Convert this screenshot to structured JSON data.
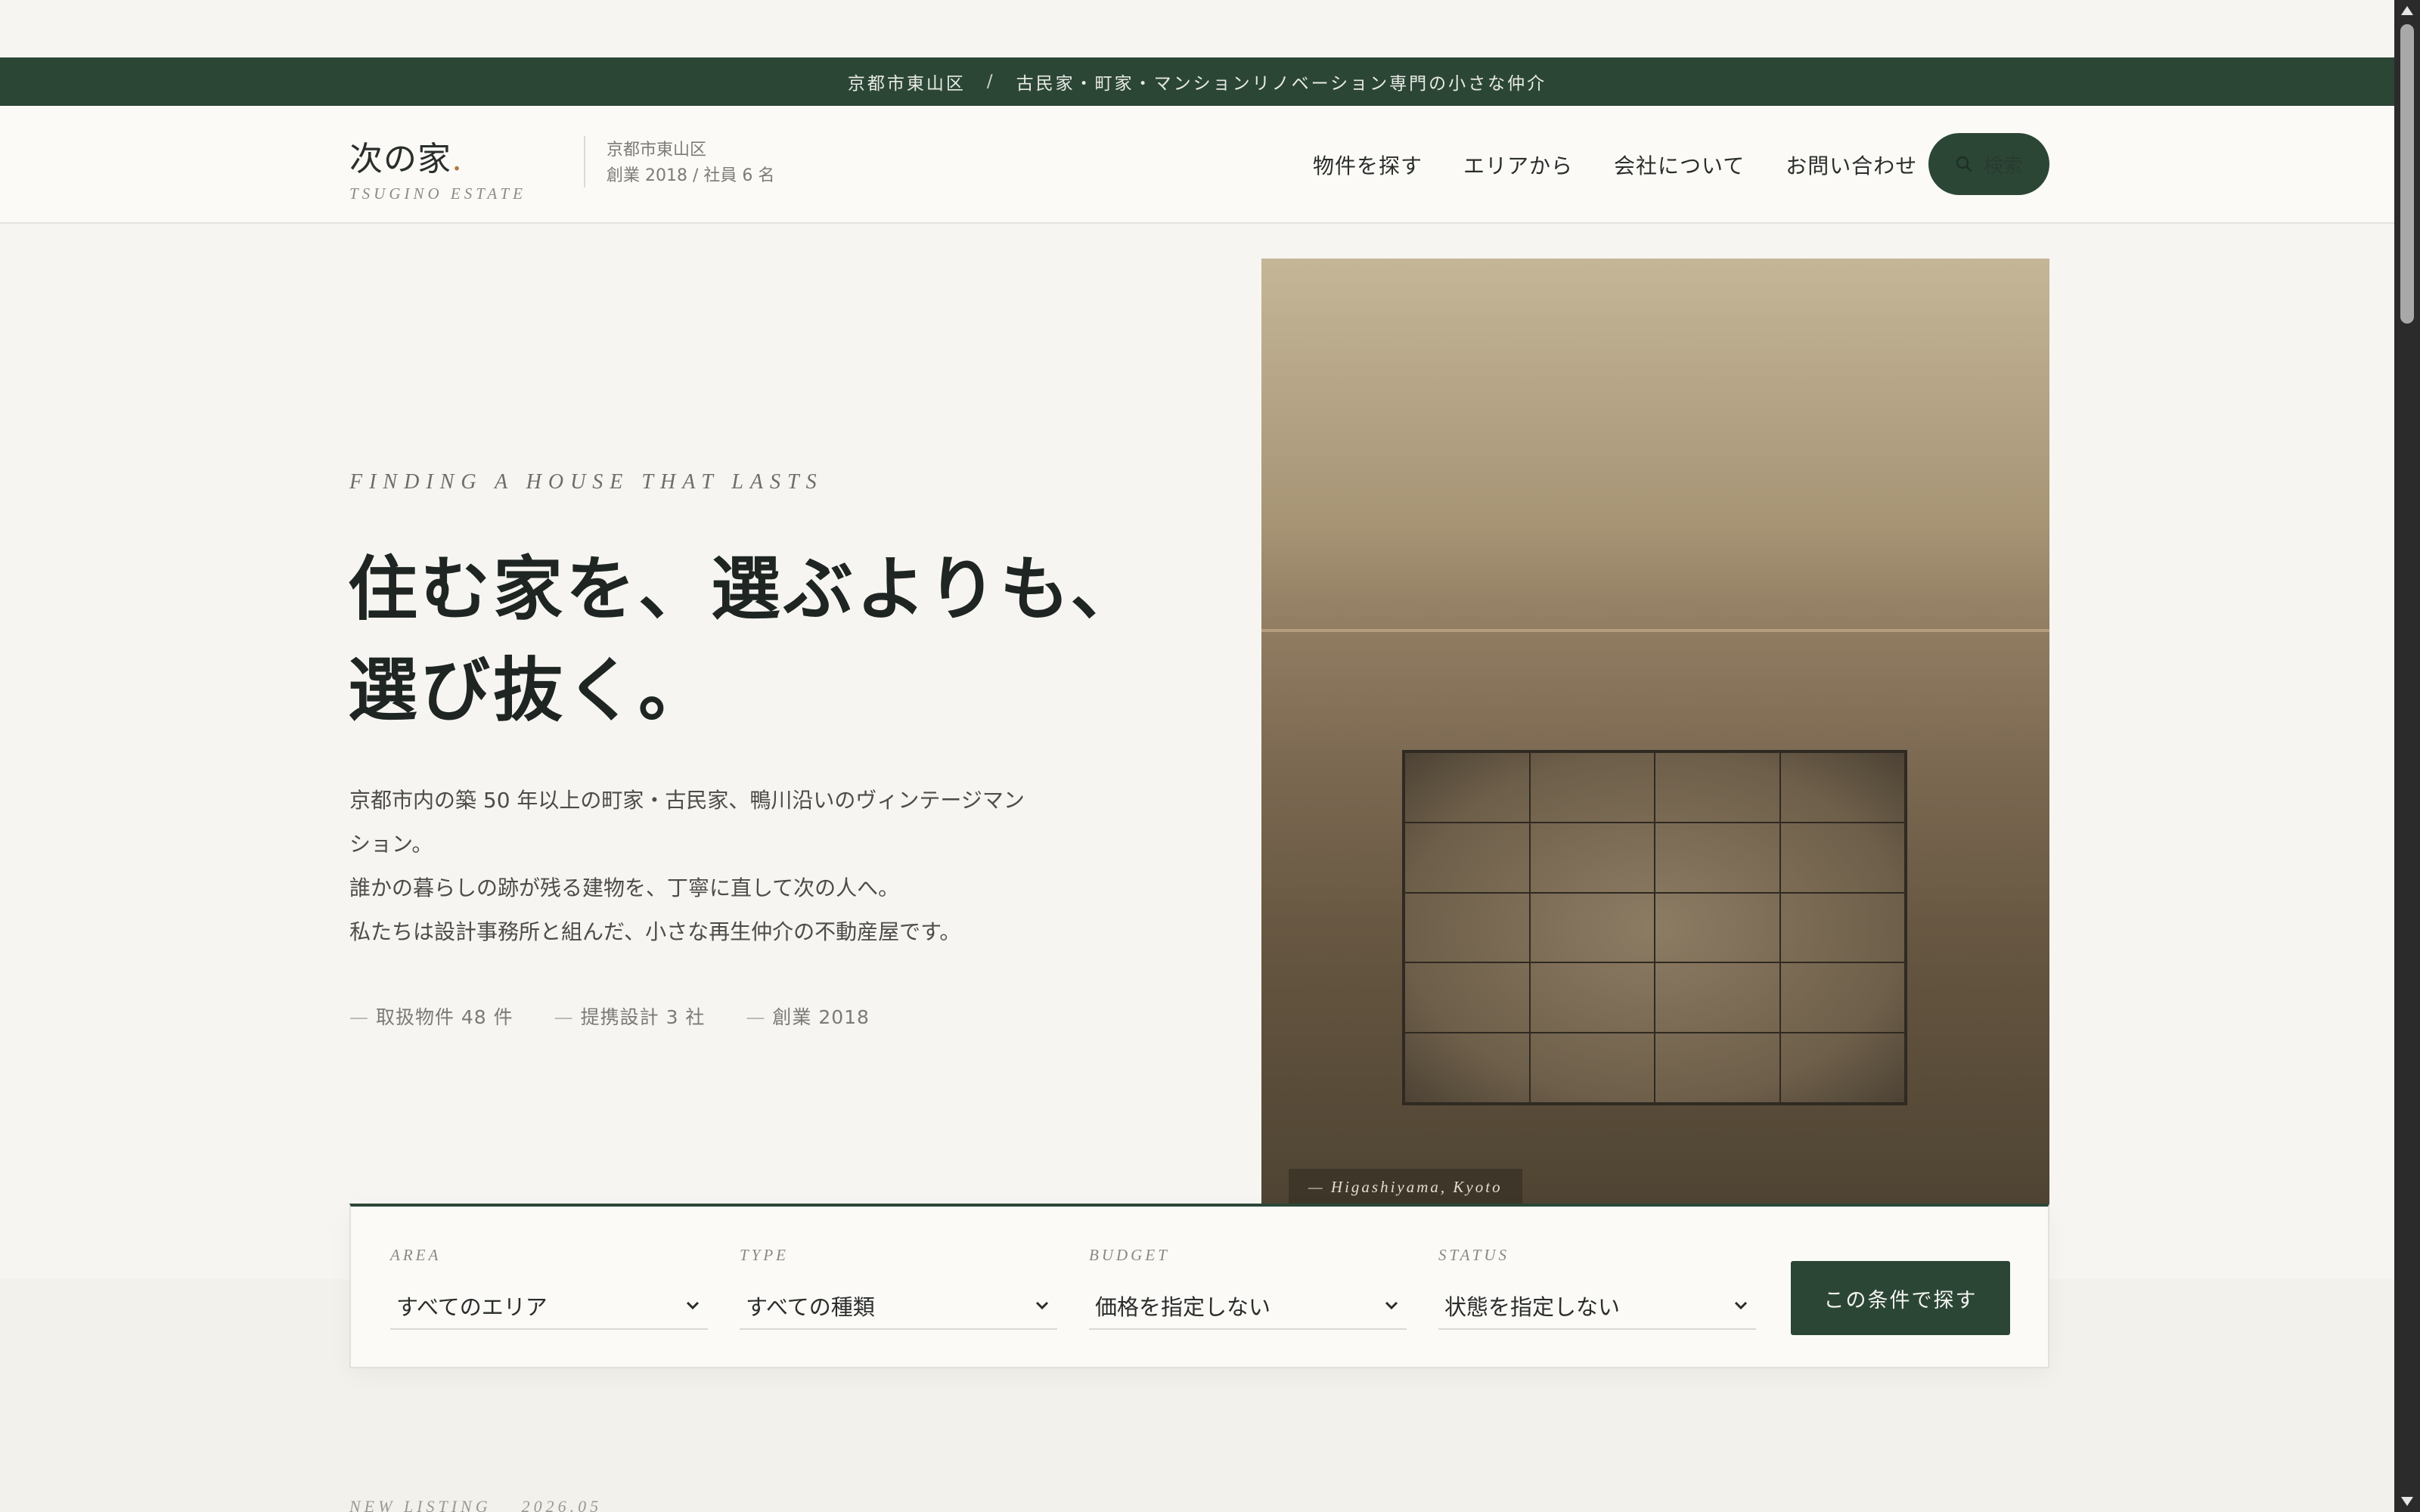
{
  "topbar": {
    "area": "京都市東山区",
    "separator": "/",
    "tagline": "古民家・町家・マンションリノベーション専門の小さな仲介"
  },
  "header": {
    "logo": "次の家",
    "logo_dot": ".",
    "logo_sub": "TSUGINO ESTATE",
    "meta_area": "京都市東山区",
    "meta_info": "創業 2018 / 社員 6 名",
    "nav": [
      "物件を探す",
      "エリアから",
      "会社について",
      "お問い合わせ"
    ],
    "search_label": "検索",
    "search_icon": "search-icon"
  },
  "hero": {
    "eyebrow": "FINDING A HOUSE THAT LASTS",
    "title_line1": "住む家を、選ぶよりも、",
    "title_line2": "選び抜く。",
    "body_line1": "京都市内の築 50 年以上の町家・古民家、鴨川沿いのヴィンテージマン",
    "body_line2": "ション。",
    "body_line3": "誰かの暮らしの跡が残る建物を、丁寧に直して次の人へ。",
    "body_line4": "私たちは設計事務所と組んだ、小さな再生仲介の不動産屋です。",
    "stats": [
      "取扱物件 48 件",
      "提携設計 3 社",
      "創業 2018"
    ],
    "image_caption": "— Higashiyama, Kyoto"
  },
  "search_panel": {
    "fields": [
      {
        "label": "AREA",
        "value": "すべてのエリア"
      },
      {
        "label": "TYPE",
        "value": "すべての種類"
      },
      {
        "label": "BUDGET",
        "value": "価格を指定しない"
      },
      {
        "label": "STATUS",
        "value": "状態を指定しない"
      }
    ],
    "submit": "この条件で探す"
  },
  "next_section": {
    "label": "NEW LISTING",
    "date": "2026.05"
  },
  "colors": {
    "primary": "#2c4636",
    "accent": "#b07a3c",
    "background": "#f6f5f1"
  }
}
